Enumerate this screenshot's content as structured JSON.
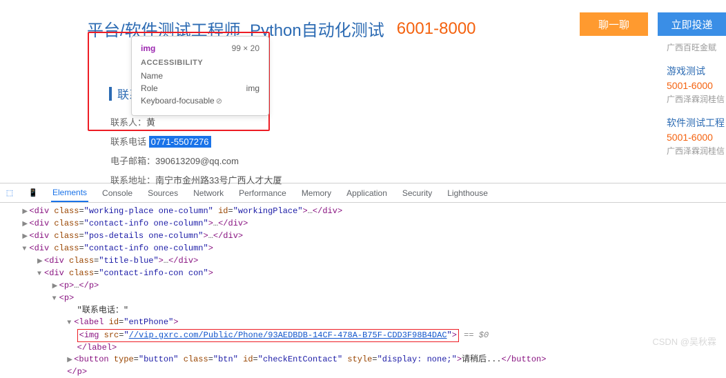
{
  "header": {
    "job_title": "平台/软件测试工程师_Python自动化测试",
    "salary": "6001-8000",
    "chat_btn": "聊一聊",
    "apply_btn": "立即投递"
  },
  "tooltip": {
    "tag": "img",
    "dimensions": "99 × 20",
    "section": "ACCESSIBILITY",
    "name_label": "Name",
    "role_label": "Role",
    "role_value": "img",
    "focus_label": "Keyboard-focusable"
  },
  "contact": {
    "title": "联系方",
    "rows": {
      "person_label": "联系人：",
      "person_value": "黄",
      "phone_label": "联系电话",
      "phone_value": "0771-5507276",
      "email_label": "电子邮箱：",
      "email_value": "390613209@qq.com",
      "address_label": "联系地址：",
      "address_value": "南宁市金州路33号广西人才大厦"
    }
  },
  "sidebar": {
    "item0_company": "广西百旺金赋",
    "item1_title": "游戏测试",
    "item1_salary": "5001-6000",
    "item1_company": "广西泽霖润桂信",
    "item2_title": "软件测试工程",
    "item2_salary": "5001-6000",
    "item2_company": "广西泽霖润桂信"
  },
  "devtools": {
    "pick_icon": "⬚",
    "mobile_icon": "📱",
    "tabs": [
      "Elements",
      "Console",
      "Sources",
      "Network",
      "Performance",
      "Memory",
      "Application",
      "Security",
      "Lighthouse"
    ],
    "code": {
      "working_place_class": "working-place one-column",
      "working_place_id": "workingPlace",
      "contact_info_class": "contact-info one-column",
      "pos_details_class": "pos-details one-column",
      "title_blue_class": "title-blue",
      "contact_info_con_class": "contact-info-con con",
      "phone_text": "\"联系电话：\"",
      "label_id": "entPhone",
      "img_src": "//vip.gxrc.com/Public/Phone/93AEDBDB-14CF-478A-B75F-CDD3F98B4DAC",
      "eq0": "== $0",
      "btn_class": "btn",
      "btn_id": "checkEntContact",
      "btn_style": "display: none;",
      "btn_text": "请稍后..."
    }
  },
  "watermark": "CSDN @吴秋霖"
}
